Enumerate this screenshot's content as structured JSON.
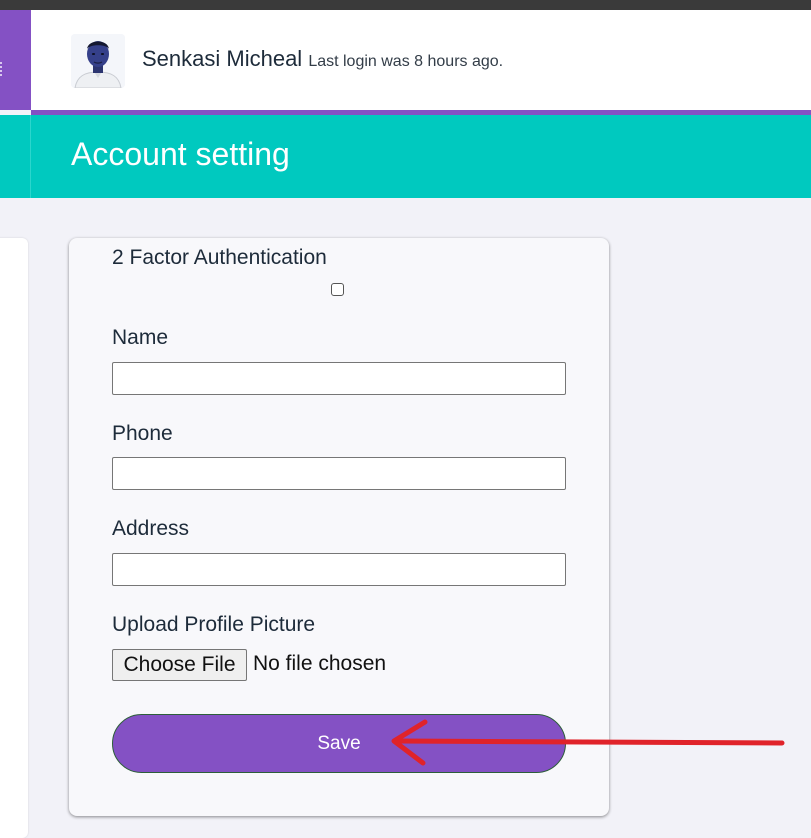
{
  "user": {
    "name": "Senkasi Micheal",
    "last_login": "Last login was 8 hours ago."
  },
  "page": {
    "title": "Account setting"
  },
  "form": {
    "two_factor_label": "2 Factor Authentication",
    "two_factor_checked": false,
    "name_label": "Name",
    "name_value": "",
    "phone_label": "Phone",
    "phone_value": "",
    "address_label": "Address",
    "address_value": "",
    "upload_label": "Upload Profile Picture",
    "choose_file_label": "Choose File",
    "file_status": "No file chosen",
    "save_label": "Save"
  },
  "colors": {
    "accent_purple": "#8451c4",
    "banner_teal": "#00c9bf",
    "annotation_red": "#e0232a"
  },
  "icons": {
    "avatar": "user-avatar-photo",
    "annotation": "red-arrow-icon"
  }
}
